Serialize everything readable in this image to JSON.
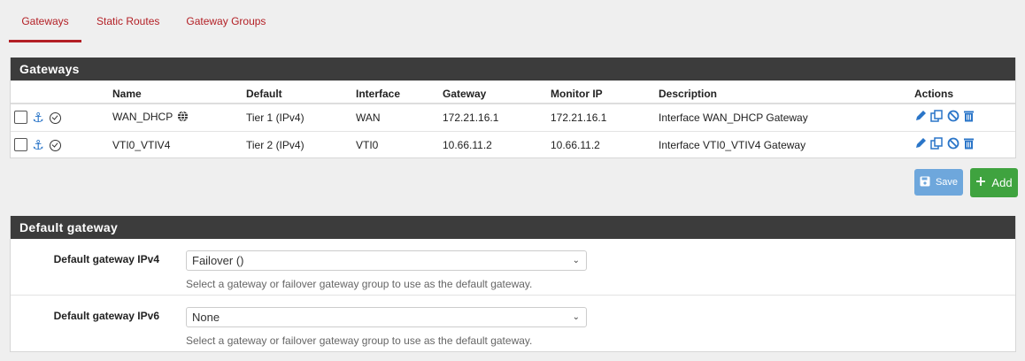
{
  "tabs": [
    {
      "label": "Gateways",
      "active": true
    },
    {
      "label": "Static Routes",
      "active": false
    },
    {
      "label": "Gateway Groups",
      "active": false
    }
  ],
  "gateways_panel": {
    "title": "Gateways",
    "columns": [
      "Name",
      "Default",
      "Interface",
      "Gateway",
      "Monitor IP",
      "Description",
      "Actions"
    ],
    "rows": [
      {
        "name": "WAN_DHCP",
        "default": "Tier 1 (IPv4)",
        "interface": "WAN",
        "gateway": "172.21.16.1",
        "monitor_ip": "172.21.16.1",
        "description": "Interface WAN_DHCP Gateway"
      },
      {
        "name": "VTI0_VTIV4",
        "default": "Tier 2 (IPv4)",
        "interface": "VTI0",
        "gateway": "10.66.11.2",
        "monitor_ip": "10.66.11.2",
        "description": "Interface VTI0_VTIV4 Gateway"
      }
    ]
  },
  "buttons": {
    "save": "Save",
    "add": "Add"
  },
  "default_panel": {
    "title": "Default gateway",
    "ipv4": {
      "label": "Default gateway IPv4",
      "value": "Failover ()",
      "help": "Select a gateway or failover gateway group to use as the default gateway."
    },
    "ipv6": {
      "label": "Default gateway IPv6",
      "value": "None",
      "help": "Select a gateway or failover gateway group to use as the default gateway."
    }
  },
  "colors": {
    "accent": "#b31f25",
    "heading_bg": "#3c3c3c",
    "save_bg": "#6ea7dc",
    "add_bg": "#3fa33f",
    "icon_blue": "#2a75c8"
  }
}
